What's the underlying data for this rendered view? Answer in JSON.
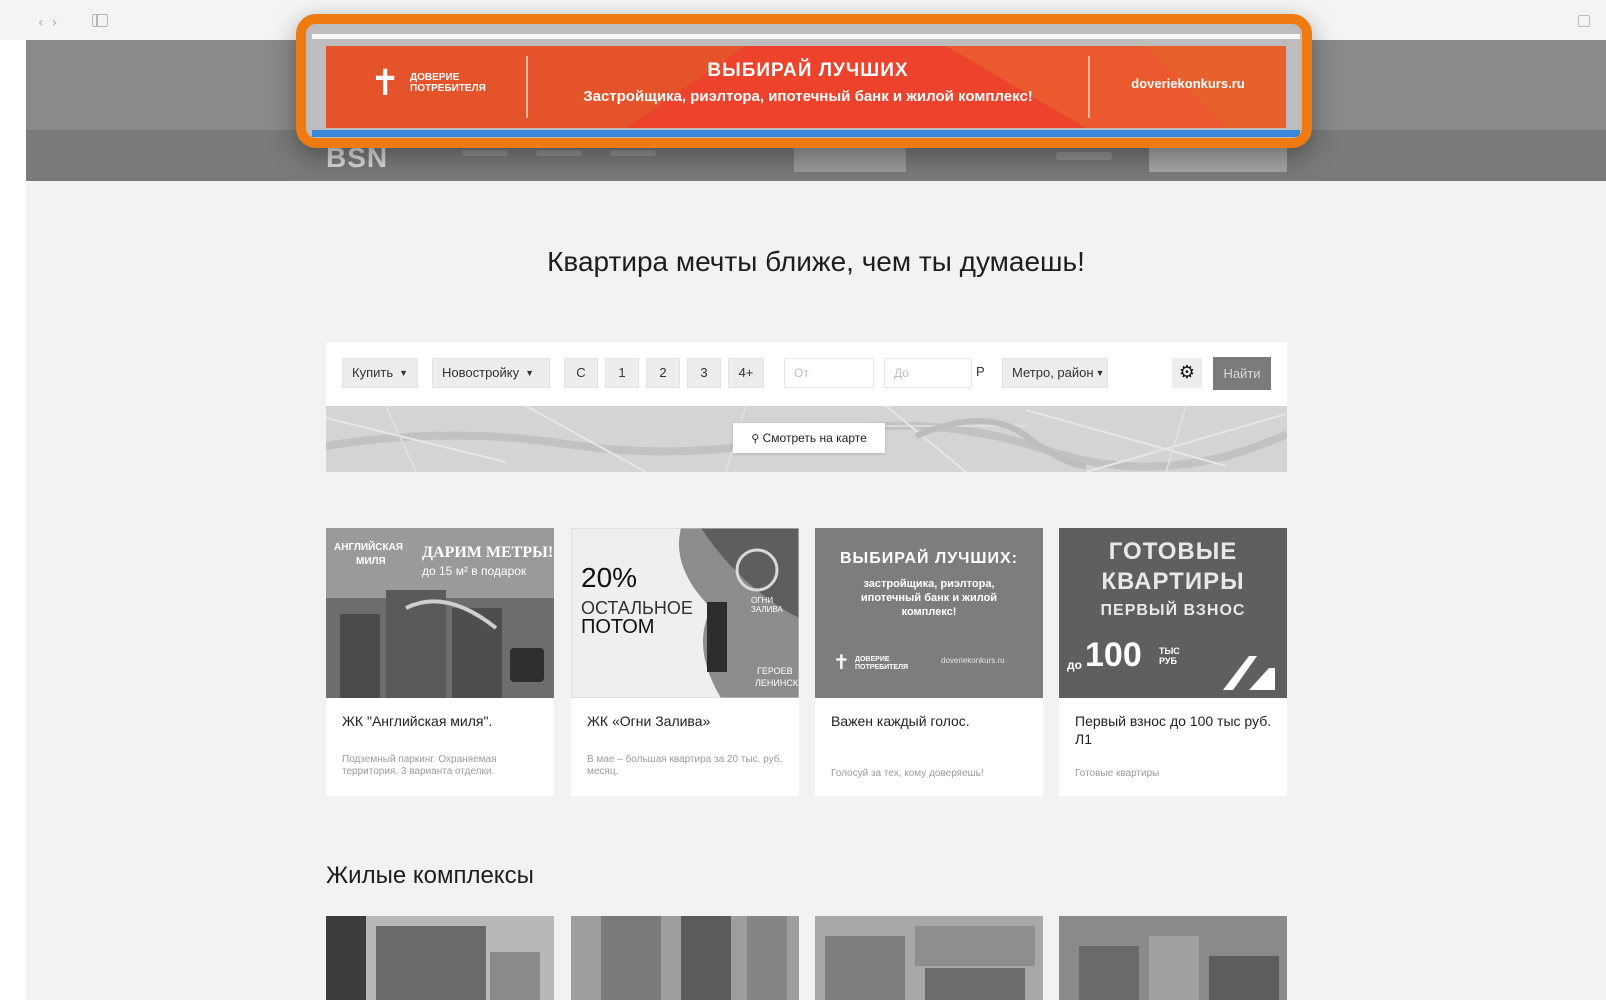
{
  "browser": {
    "back_glyph": "‹",
    "forward_glyph": "›",
    "close_glyph": "×"
  },
  "header": {
    "logo": "BSN"
  },
  "headline": "Квартира мечты ближе, чем ты думаешь!",
  "search": {
    "deal_type": "Купить",
    "property_type": "Новостройку",
    "rooms": [
      "С",
      "1",
      "2",
      "3",
      "4+"
    ],
    "price_from_placeholder": "От",
    "price_to_placeholder": "До",
    "currency": "Р",
    "location": "Метро, район",
    "find_label": "Найти",
    "map_button": "Смотреть на карте"
  },
  "promo_cards": [
    {
      "title": "ЖК \"Английская миля\".",
      "description": "Подземный паркинг. Охраняемая территория. 3 варианта отделки.",
      "image_text": {
        "brand_top": "АНГЛИЙСКАЯ",
        "brand_bottom": "МИЛЯ",
        "line1": "ДАРИМ МЕТРЫ!",
        "line2": "до 15 м² в подарок"
      }
    },
    {
      "title": "ЖК «Огни Залива»",
      "description": "В мае – большая квартира за 20 тыс. руб. месяц.",
      "image_text": {
        "percent": "20%",
        "rest1": "ОСТАЛЬНОЕ",
        "rest2": "ПОТОМ",
        "brand": "ОГНИ ЗАЛИВА",
        "place1": "ГЕРОЕВ",
        "place2": "ЛЕНИНСКИЙ"
      }
    },
    {
      "title": "Важен каждый голос.",
      "description": "Голосуй за тех, кому доверяешь!",
      "image_text": {
        "line1": "ВЫБИРАЙ ЛУЧШИХ:",
        "line2": "застройщика, риэлтора,",
        "line3": "ипотечный банк и жилой",
        "line4": "комплекс!",
        "logo": "ДОВЕРИЕ ПОТРЕБИТЕЛЯ",
        "url": "doveriekonkurs.ru"
      }
    },
    {
      "title": "Первый взнос до 100 тыс руб. Л1",
      "description": "Готовые квартиры",
      "image_text": {
        "line1": "ГОТОВЫЕ",
        "line2": "КВАРТИРЫ",
        "line3": "ПЕРВЫЙ ВЗНОС",
        "prefix": "до",
        "amount": "100",
        "unit1": "ТЫС",
        "unit2": "РУБ"
      }
    }
  ],
  "complexes_title": "Жилые комплексы",
  "banner": {
    "logo_text": "ДОВЕРИЕ ПОТРЕБИТЕЛЯ",
    "title": "ВЫБИРАЙ ЛУЧШИХ",
    "subtitle": "Застройщика, риэлтора, ипотечный банк и жилой комплекс!",
    "url": "doveriekonkurs.ru"
  },
  "colors": {
    "highlight": "#f07a12",
    "banner": "#e4532a",
    "accent_blue": "#3a86d6"
  }
}
